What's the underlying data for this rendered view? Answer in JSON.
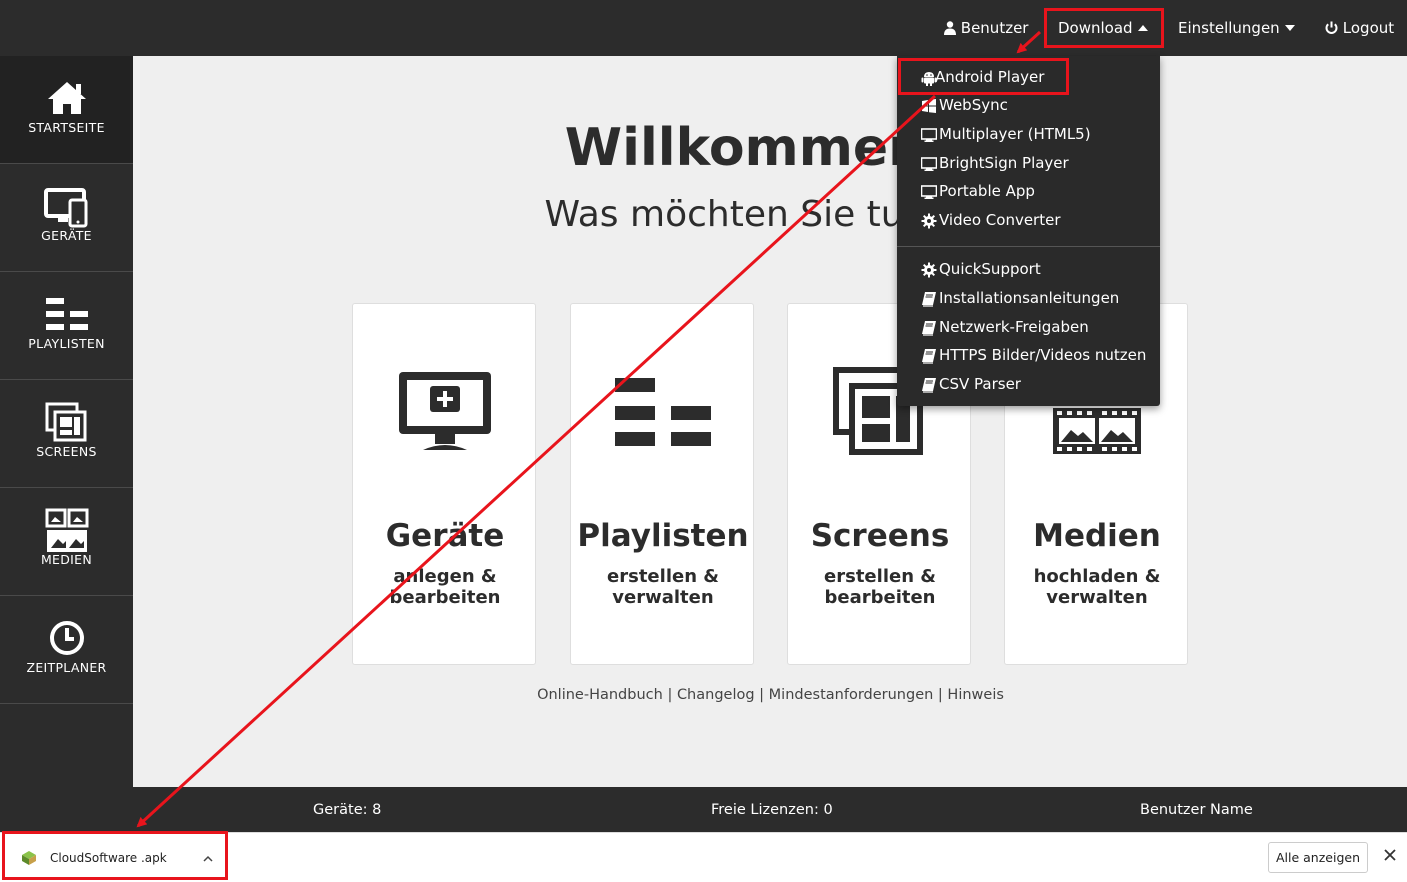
{
  "topnav": {
    "user_label": "Benutzer",
    "download_label": "Download",
    "settings_label": "Einstellungen",
    "logout_label": "Logout"
  },
  "sidebar": {
    "items": [
      {
        "label": "STARTSEITE",
        "icon": "home-icon"
      },
      {
        "label": "GERÄTE",
        "icon": "devices-icon"
      },
      {
        "label": "PLAYLISTEN",
        "icon": "playlist-icon"
      },
      {
        "label": "SCREENS",
        "icon": "screens-icon"
      },
      {
        "label": "MEDIEN",
        "icon": "media-icon"
      },
      {
        "label": "ZEITPLANER",
        "icon": "clock-icon"
      }
    ]
  },
  "main": {
    "welcome": "Willkommen",
    "question": "Was möchten Sie tun?",
    "cards": [
      {
        "title": "Geräte",
        "line1": "anlegen &",
        "line2": "bearbeiten",
        "icon": "monitor-add-icon"
      },
      {
        "title": "Playlisten",
        "line1": "erstellen &",
        "line2": "verwalten",
        "icon": "playlist-icon"
      },
      {
        "title": "Screens",
        "line1": "erstellen &",
        "line2": "bearbeiten",
        "icon": "screens-icon"
      },
      {
        "title": "Medien",
        "line1": "hochladen &",
        "line2": "verwalten",
        "icon": "filmstrip-icon"
      }
    ],
    "links": [
      "Online-Handbuch",
      "Changelog",
      "Mindestanforderungen",
      "Hinweis"
    ]
  },
  "dropdown": {
    "items": [
      {
        "label": "Android Player",
        "icon": "android-icon"
      },
      {
        "label": "WebSync",
        "icon": "windows-icon"
      },
      {
        "label": "Multiplayer (HTML5)",
        "icon": "monitor-icon"
      },
      {
        "label": "BrightSign Player",
        "icon": "monitor-icon"
      },
      {
        "label": "Portable App",
        "icon": "monitor-icon"
      },
      {
        "label": "Video Converter",
        "icon": "gear-icon"
      },
      {
        "label": "QuickSupport",
        "icon": "gear-icon"
      },
      {
        "label": "Installationsanleitungen",
        "icon": "book-icon"
      },
      {
        "label": "Netzwerk-Freigaben",
        "icon": "book-icon"
      },
      {
        "label": "HTTPS Bilder/Videos nutzen",
        "icon": "book-icon"
      },
      {
        "label": "CSV Parser",
        "icon": "book-icon"
      }
    ]
  },
  "footer": {
    "devices": "Geräte: 8",
    "licenses": "Freie Lizenzen: 0",
    "username": "Benutzer Name"
  },
  "downloads": {
    "filename": "CloudSoftware .apk",
    "show_all": "Alle anzeigen"
  },
  "colors": {
    "dark": "#2c2c2c",
    "content_bg": "#efefef",
    "highlight": "#e8141c"
  }
}
